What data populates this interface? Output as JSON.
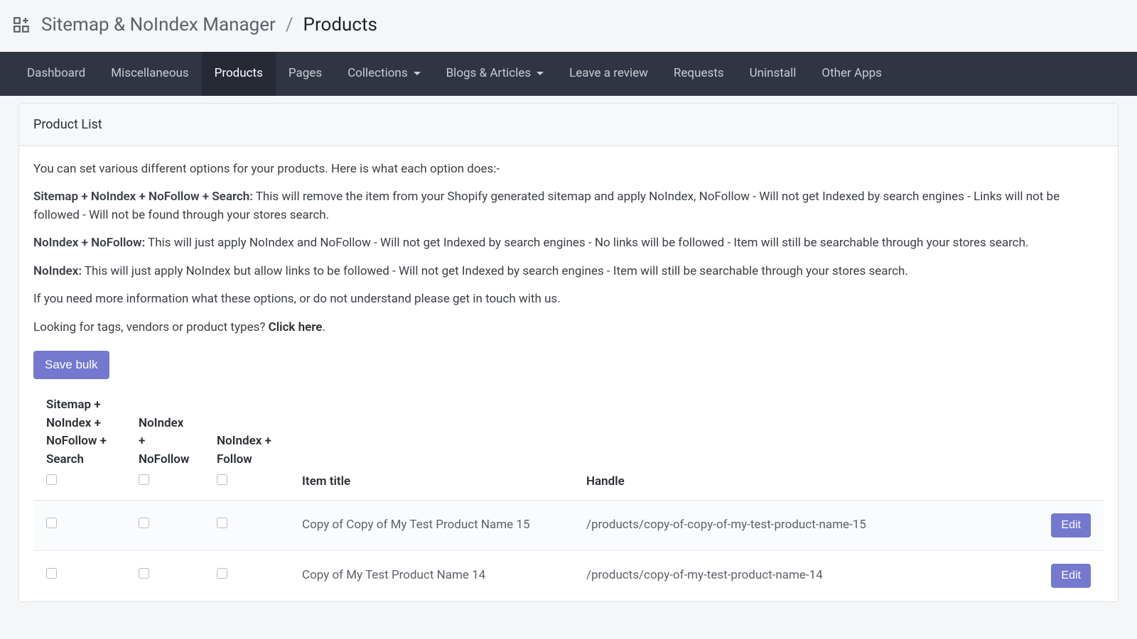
{
  "breadcrumb": {
    "app_name": "Sitemap & NoIndex Manager",
    "sep": "/",
    "current": "Products"
  },
  "nav": {
    "items": [
      {
        "label": "Dashboard",
        "active": false,
        "dropdown": false
      },
      {
        "label": "Miscellaneous",
        "active": false,
        "dropdown": false
      },
      {
        "label": "Products",
        "active": true,
        "dropdown": false
      },
      {
        "label": "Pages",
        "active": false,
        "dropdown": false
      },
      {
        "label": "Collections",
        "active": false,
        "dropdown": true
      },
      {
        "label": "Blogs & Articles",
        "active": false,
        "dropdown": true
      },
      {
        "label": "Leave a review",
        "active": false,
        "dropdown": false
      },
      {
        "label": "Requests",
        "active": false,
        "dropdown": false
      },
      {
        "label": "Uninstall",
        "active": false,
        "dropdown": false
      },
      {
        "label": "Other Apps",
        "active": false,
        "dropdown": false
      }
    ]
  },
  "panel": {
    "title": "Product List",
    "intro": "You can set various different options for your products. Here is what each option does:-",
    "opt1_label": "Sitemap + NoIndex + NoFollow + Search:",
    "opt1_text": " This will remove the item from your Shopify generated sitemap and apply NoIndex, NoFollow - Will not get Indexed by search engines - Links will not be followed - Will not be found through your stores search.",
    "opt2_label": "NoIndex + NoFollow:",
    "opt2_text": " This will just apply NoIndex and NoFollow - Will not get Indexed by search engines - No links will be followed - Item will still be searchable through your stores search.",
    "opt3_label": "NoIndex:",
    "opt3_text": " This will just apply NoIndex but allow links to be followed - Will not get Indexed by search engines - Item will still be searchable through your stores search.",
    "info": "If you need more information what these options, or do not understand please get in touch with us.",
    "tags_prefix": "Looking for tags, vendors or product types? ",
    "tags_link": "Click here",
    "tags_suffix": ".",
    "save_bulk": "Save bulk",
    "table": {
      "headers": {
        "c1": "Sitemap + NoIndex + NoFollow + Search",
        "c2": "NoIndex + NoFollow",
        "c3": "NoIndex + Follow",
        "c4": "Item title",
        "c5": "Handle"
      },
      "rows": [
        {
          "title": "Copy of Copy of My Test Product Name 15",
          "handle": "/products/copy-of-copy-of-my-test-product-name-15",
          "edit": "Edit"
        },
        {
          "title": "Copy of My Test Product Name 14",
          "handle": "/products/copy-of-my-test-product-name-14",
          "edit": "Edit"
        }
      ]
    }
  }
}
